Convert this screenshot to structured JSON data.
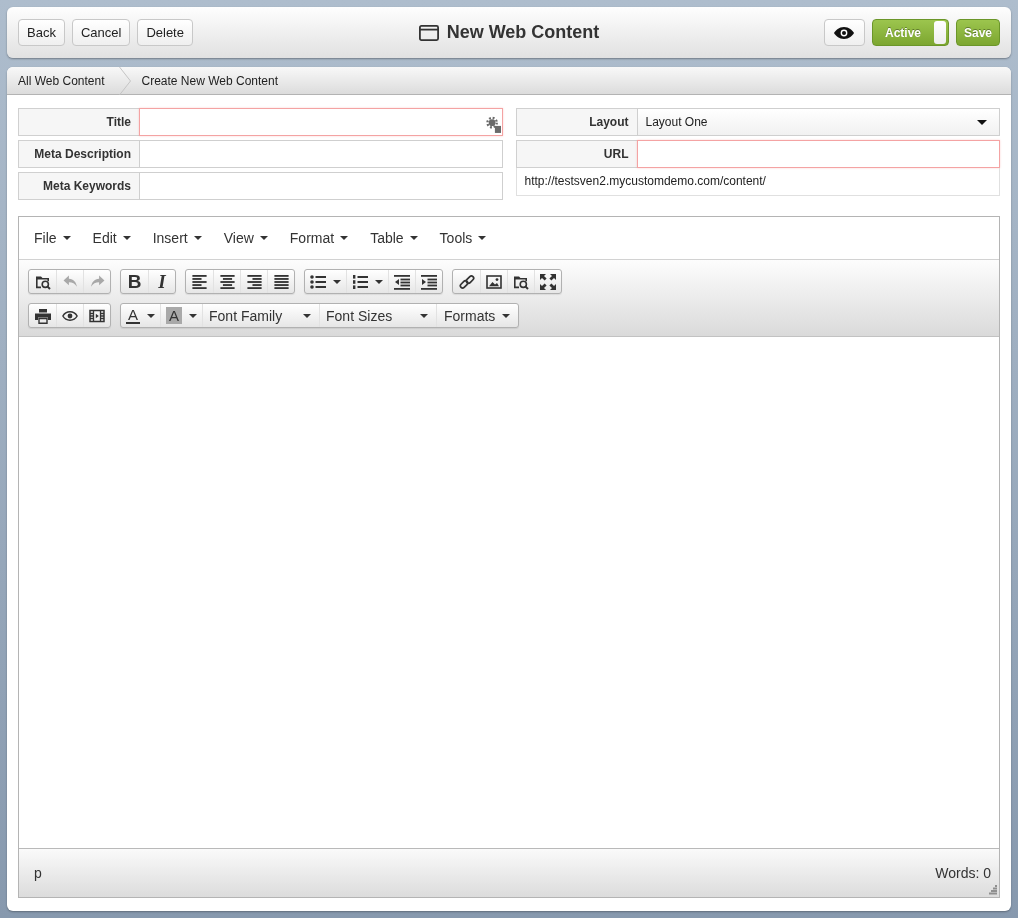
{
  "top_bar": {
    "buttons": [
      {
        "label": "Back"
      },
      {
        "label": "Cancel"
      },
      {
        "label": "Delete"
      }
    ],
    "title": "New Web Content",
    "status_toggle": {
      "label": "Active",
      "on": true
    },
    "save_button": {
      "label": "Save"
    }
  },
  "breadcrumb": [
    {
      "label": "All Web Content"
    },
    {
      "label": "Create New Web Content"
    }
  ],
  "form": {
    "left_fields": [
      {
        "label": "Title",
        "kind": "text",
        "invalid": true,
        "tool_icon": true
      },
      {
        "label": "Meta Description",
        "kind": "text",
        "invalid": false,
        "tool_icon": false
      },
      {
        "label": "Meta Keywords",
        "kind": "text",
        "invalid": false,
        "tool_icon": false
      }
    ],
    "right_fields": [
      {
        "label": "Layout",
        "kind": "select",
        "value": "Layout One",
        "invalid": false,
        "tool_icon": false
      },
      {
        "label": "URL",
        "kind": "text",
        "invalid": true,
        "tool_icon": false
      }
    ],
    "url_hint": "http://testsven2.mycustomdemo.com/content/"
  },
  "editor": {
    "menus": [
      {
        "label": "File"
      },
      {
        "label": "Edit"
      },
      {
        "label": "Insert"
      },
      {
        "label": "View"
      },
      {
        "label": "Format"
      },
      {
        "label": "Table"
      },
      {
        "label": "Tools"
      }
    ],
    "toolbar": [
      [
        [
          {
            "kind": "browse",
            "disabled": false
          },
          {
            "kind": "undo",
            "disabled": true
          },
          {
            "kind": "redo",
            "disabled": true
          }
        ],
        [
          {
            "kind": "bold",
            "label": "B",
            "disabled": false
          },
          {
            "kind": "italic",
            "label": "I",
            "disabled": false
          }
        ],
        [
          {
            "kind": "alignleft",
            "disabled": false
          },
          {
            "kind": "aligncenter",
            "disabled": false
          },
          {
            "kind": "alignright",
            "disabled": false
          },
          {
            "kind": "justify",
            "disabled": false
          }
        ],
        [
          {
            "kind": "bullist",
            "disabled": false
          },
          {
            "kind": "numlist",
            "disabled": false
          },
          {
            "kind": "outdent",
            "disabled": false
          },
          {
            "kind": "indent",
            "disabled": false
          }
        ],
        [
          {
            "kind": "link",
            "disabled": false
          },
          {
            "kind": "image",
            "disabled": false
          },
          {
            "kind": "browse",
            "disabled": false
          },
          {
            "kind": "fullscreen",
            "disabled": false
          }
        ]
      ],
      [
        [
          {
            "kind": "print",
            "disabled": false
          },
          {
            "kind": "preview",
            "disabled": false
          },
          {
            "kind": "media",
            "disabled": false
          }
        ],
        [
          {
            "kind": "forecolor",
            "label": "A",
            "disabled": false
          },
          {
            "kind": "backcolor",
            "label": "A",
            "disabled": false
          },
          {
            "kind": "listbox",
            "label": "Font Family",
            "disabled": false
          },
          {
            "kind": "listbox",
            "label": "Font Sizes",
            "disabled": false
          },
          {
            "kind": "menubutton",
            "label": "Formats",
            "disabled": false
          }
        ]
      ]
    ],
    "status_path": "p",
    "word_count": "Words: 0"
  }
}
